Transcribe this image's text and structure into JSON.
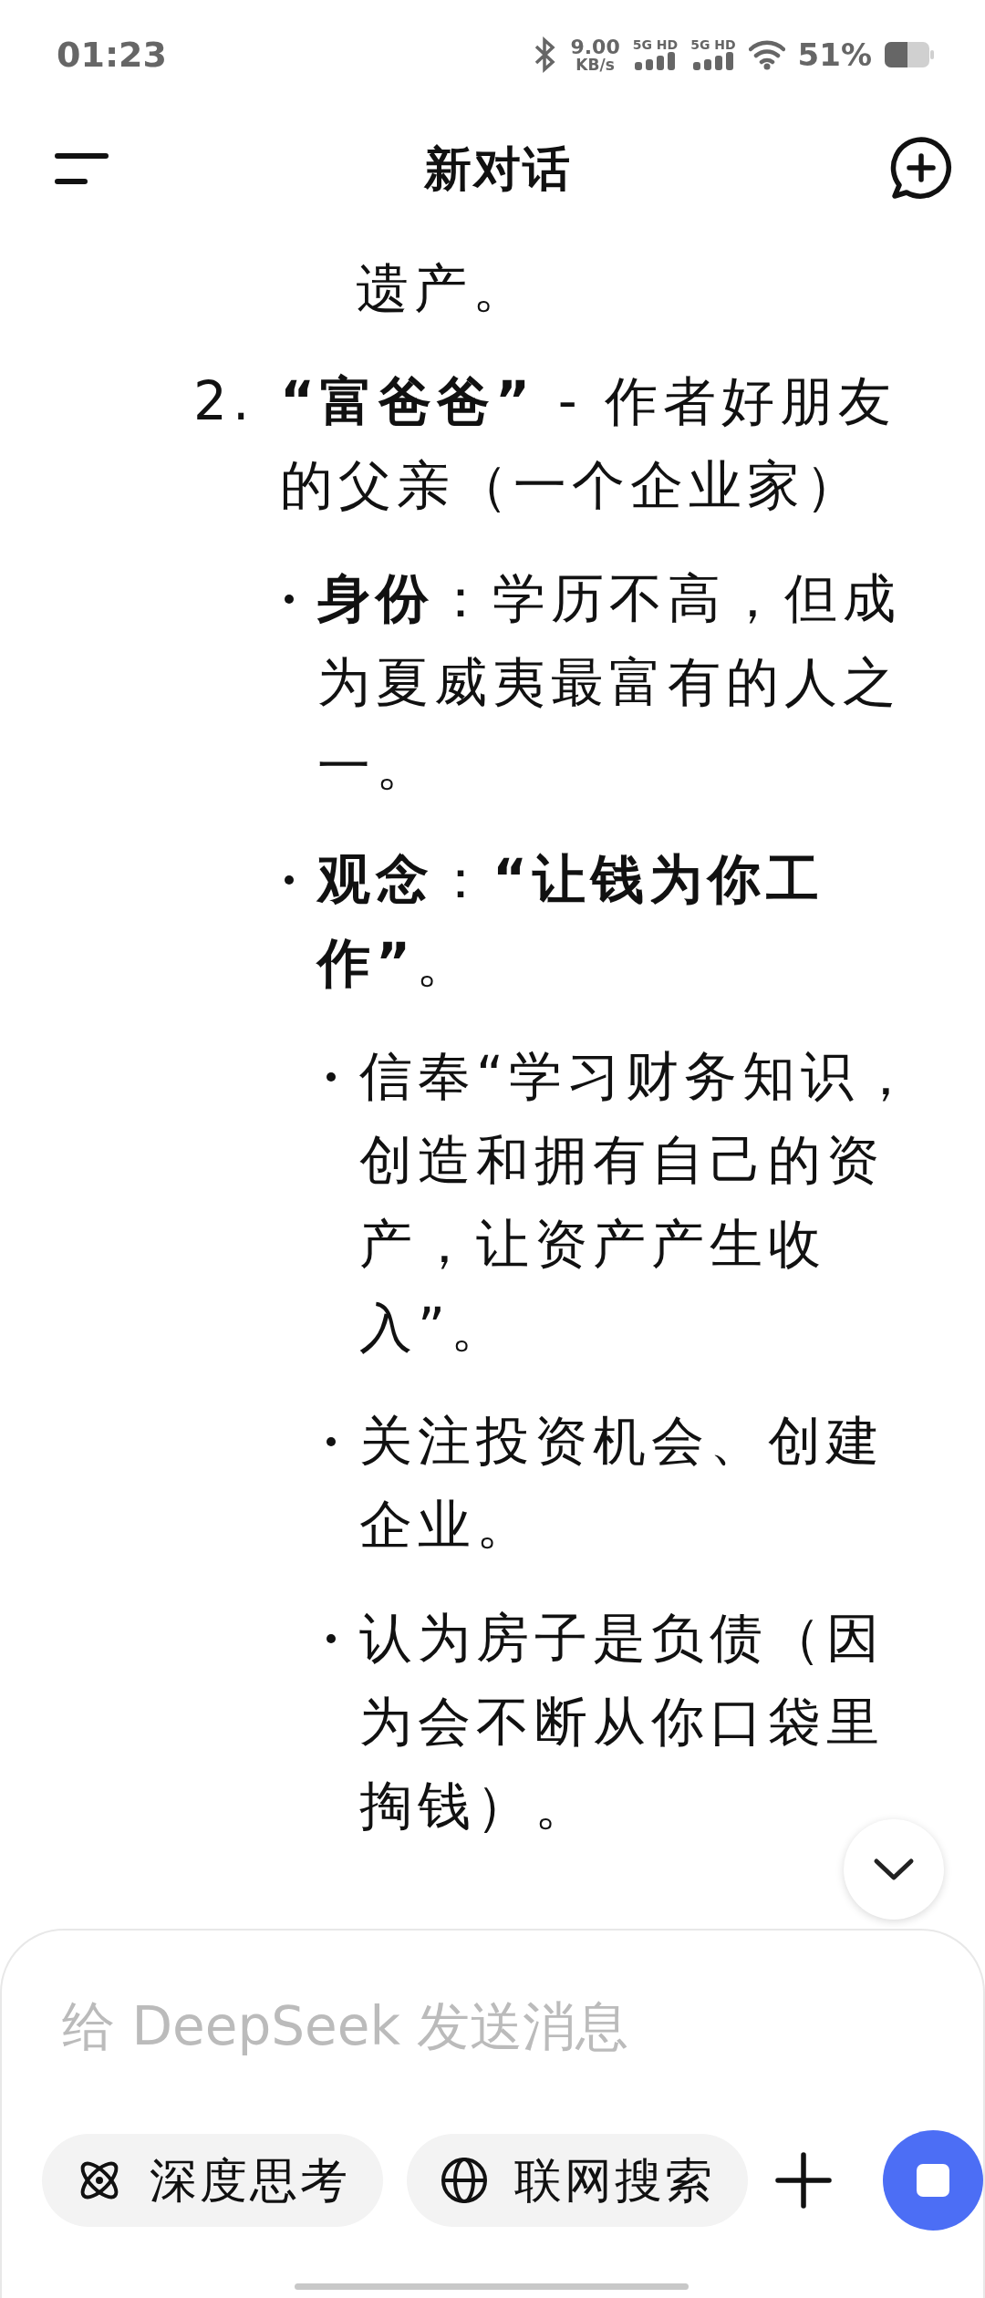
{
  "status_bar": {
    "time": "01:23",
    "net_speed": "9.00",
    "net_unit": "KB/s",
    "sims": [
      "5G HD",
      "5G HD"
    ],
    "battery": "51%"
  },
  "header": {
    "title": "新对话"
  },
  "message": [
    {
      "kind": "text",
      "text": "遗产。"
    },
    {
      "kind": "numbered",
      "number": "2.",
      "text": "**“富爸爸”** - 作者好朋友的父亲（一个企业家）",
      "children": [
        {
          "text": "**身份**：学历不高，但成为夏威夷最富有的人之一。"
        },
        {
          "text": "**观念**：**“让钱为你工作”**。",
          "children": [
            {
              "text": "信奉“学习财务知识，创造和拥有自己的资产，让资产产生收入”。"
            },
            {
              "text": "关注投资机会、创建企业。"
            },
            {
              "text": "认为房子是负债（因为会不断从你口袋里掏钱）。"
            }
          ]
        }
      ]
    }
  ],
  "composer": {
    "placeholder": "给 DeepSeek 发送消息",
    "toggles": [
      {
        "kind": "think",
        "label": "深度思考",
        "selected": false
      },
      {
        "kind": "web",
        "label": "联网搜索",
        "selected": false
      }
    ]
  }
}
